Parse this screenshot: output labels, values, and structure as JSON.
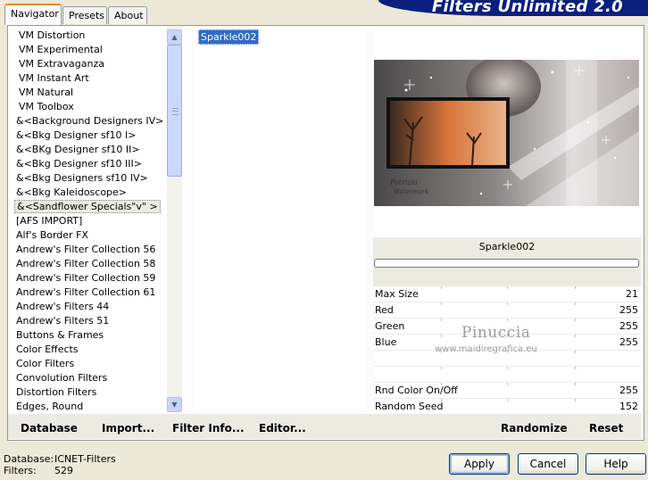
{
  "tabs": [
    {
      "label": "Navigator",
      "active": true
    },
    {
      "label": "Presets",
      "active": false
    },
    {
      "label": "About",
      "active": false
    }
  ],
  "banner": {
    "title": "Filters Unlimited 2.0",
    "color": "#0b1f7e"
  },
  "filter_list": {
    "items": [
      "VM Distortion",
      "VM Experimental",
      "VM Extravaganza",
      "VM Instant Art",
      "VM Natural",
      "VM Toolbox",
      "&<Background Designers IV>",
      "&<Bkg Designer sf10 I>",
      "&<BKg Designer sf10 II>",
      "&<Bkg Designer sf10 III>",
      "&<Bkg Designers sf10 IV>",
      "&<Bkg Kaleidoscope>",
      "&<Sandflower Specials\"v\" >",
      "[AFS IMPORT]",
      "Alf's Border FX",
      "Andrew's Filter Collection 56",
      "Andrew's Filter Collection 58",
      "Andrew's Filter Collection 59",
      "Andrew's Filter Collection 61",
      "Andrew's Filters 44",
      "Andrew's Filters 51",
      "Buttons & Frames",
      "Color Effects",
      "Color Filters",
      "Convolution Filters",
      "Distortion Filters",
      "Edges, Round"
    ],
    "selected_index": 12
  },
  "filter_names": {
    "selected": "Sparkle002"
  },
  "settings": {
    "filter_name": "Sparkle002",
    "params": [
      {
        "label": "Max Size",
        "value": "21"
      },
      {
        "label": "Red",
        "value": "255"
      },
      {
        "label": "Green",
        "value": "255"
      },
      {
        "label": "Blue",
        "value": "255"
      },
      {
        "label": "",
        "value": ""
      },
      {
        "label": "",
        "value": ""
      },
      {
        "label": "Rnd Color On/Off",
        "value": "255"
      },
      {
        "label": "Random Seed",
        "value": "152"
      }
    ]
  },
  "watermark": {
    "name": "Pinuccia",
    "url": "www.maidiregrafica.eu"
  },
  "preview_caption": "Patrizia\nWatermark",
  "toolbar": {
    "database": "Database",
    "import": "Import...",
    "filter_info": "Filter Info...",
    "editor": "Editor...",
    "randomize": "Randomize",
    "reset": "Reset"
  },
  "status": {
    "database_label": "Database:",
    "database_value": "ICNET-Filters",
    "filters_label": "Filters:",
    "filters_value": "529"
  },
  "buttons": {
    "apply": "Apply",
    "cancel": "Cancel",
    "help": "Help"
  }
}
